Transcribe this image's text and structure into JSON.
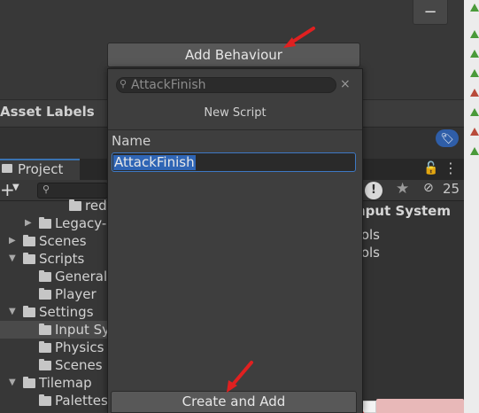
{
  "inspector": {
    "minus_label": "−",
    "add_behaviour_label": "Add Behaviour"
  },
  "asset_labels": {
    "title": "Asset Labels",
    "tag_icon": "tag-icon"
  },
  "project_panel": {
    "tab_label": "Project",
    "plus_label": "+",
    "hidden_count": "25",
    "tree": [
      {
        "label": "red",
        "indent": 4
      },
      {
        "label": "Legacy-",
        "indent": 3,
        "arrow": "▶"
      },
      {
        "label": "Scenes",
        "indent": 1,
        "arrow": "▶"
      },
      {
        "label": "Scripts",
        "indent": 1,
        "arrow": "▼"
      },
      {
        "label": "General",
        "indent": 2
      },
      {
        "label": "Player",
        "indent": 2
      },
      {
        "label": "Settings",
        "indent": 1,
        "arrow": "▼"
      },
      {
        "label": "Input Sy",
        "indent": 2,
        "selected": true
      },
      {
        "label": "Physics",
        "indent": 2
      },
      {
        "label": "Scenes",
        "indent": 2
      },
      {
        "label": "Tilemap",
        "indent": 1,
        "arrow": "▼"
      },
      {
        "label": "Palettes",
        "indent": 2
      }
    ],
    "right_header": "nput System",
    "right_items": [
      "rols",
      "rols"
    ]
  },
  "popup": {
    "search_value": "AttackFinish",
    "clear_label": "×",
    "title": "New Script",
    "name_label": "Name",
    "name_value": "AttackFinish",
    "create_add_label": "Create and Add"
  },
  "colors": {
    "accent_blue": "#3a72b0",
    "selection_blue": "#2f65b5",
    "annotation_red": "#e02020"
  }
}
